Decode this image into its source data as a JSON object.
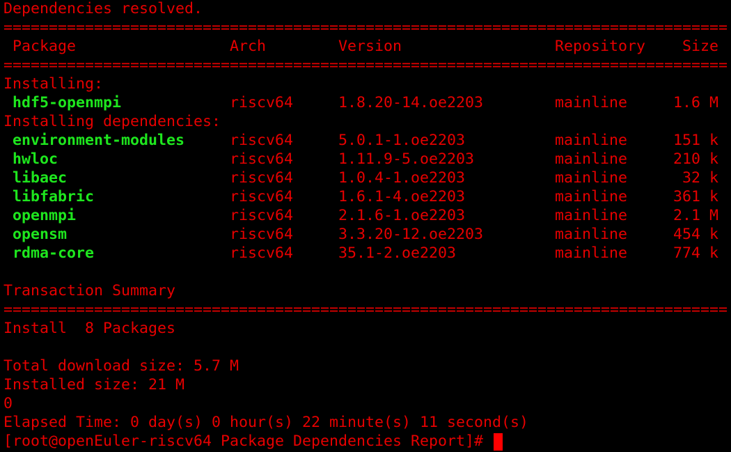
{
  "colors": {
    "background": "#000000",
    "text": "#e60000",
    "package_name": "#1ee61e",
    "cursor": "#ff0000"
  },
  "status_line": "Dependencies resolved.",
  "separator": "======================================================================================================================================================",
  "headers": {
    "package": "Package",
    "arch": "Arch",
    "version": "Version",
    "repository": "Repository",
    "size": "Size"
  },
  "installing_label": "Installing:",
  "installing": [
    {
      "name": "hdf5-openmpi",
      "arch": "riscv64",
      "version": "1.8.20-14.oe2203",
      "repo": "mainline",
      "size": "1.6 M"
    }
  ],
  "dependencies_label": "Installing dependencies:",
  "dependencies": [
    {
      "name": "environment-modules",
      "arch": "riscv64",
      "version": "5.0.1-1.oe2203",
      "repo": "mainline",
      "size": "151 k"
    },
    {
      "name": "hwloc",
      "arch": "riscv64",
      "version": "1.11.9-5.oe2203",
      "repo": "mainline",
      "size": "210 k"
    },
    {
      "name": "libaec",
      "arch": "riscv64",
      "version": "1.0.4-1.oe2203",
      "repo": "mainline",
      "size": "32 k"
    },
    {
      "name": "libfabric",
      "arch": "riscv64",
      "version": "1.6.1-4.oe2203",
      "repo": "mainline",
      "size": "361 k"
    },
    {
      "name": "openmpi",
      "arch": "riscv64",
      "version": "2.1.6-1.oe2203",
      "repo": "mainline",
      "size": "2.1 M"
    },
    {
      "name": "opensm",
      "arch": "riscv64",
      "version": "3.3.20-12.oe2203",
      "repo": "mainline",
      "size": "454 k"
    },
    {
      "name": "rdma-core",
      "arch": "riscv64",
      "version": "35.1-2.oe2203",
      "repo": "mainline",
      "size": "774 k"
    }
  ],
  "summary_title": "Transaction Summary",
  "install_summary": "Install  8 Packages",
  "total_download": "Total download size: 5.7 M",
  "installed_size": "Installed size: 21 M",
  "exit_code": "0",
  "elapsed": "Elapsed Time: 0 day(s) 0 hour(s) 22 minute(s) 11 second(s)",
  "prompt": "[root@openEuler-riscv64 Package Dependencies Report]# "
}
